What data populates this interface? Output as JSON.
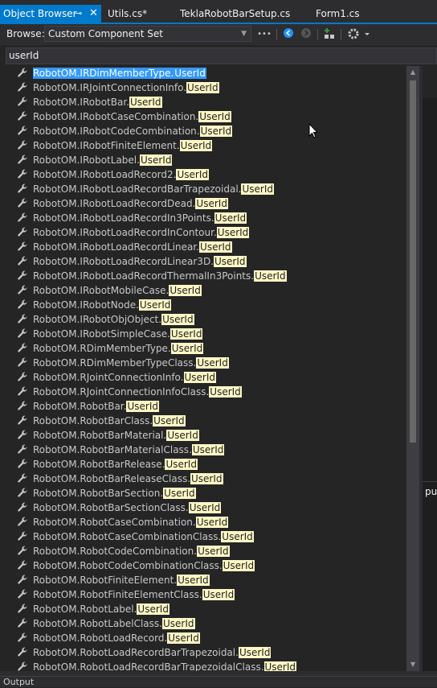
{
  "tabs": {
    "active": "Object Browser",
    "pin_glyph": "⊸",
    "close_glyph": "✕",
    "others": [
      "Utils.cs*",
      "TeklaRobotBarSetup.cs",
      "Form1.cs"
    ]
  },
  "toolbar": {
    "browse_label": "Browse:",
    "browse_value": "Custom Component Set",
    "more": "•••"
  },
  "search": {
    "value": "userId"
  },
  "results": {
    "rows": [
      {
        "prefix": "RobotOM.IRDimMemberType.",
        "match": "UserId"
      },
      {
        "prefix": "RobotOM.IRJointConnectionInfo.",
        "match": "UserId"
      },
      {
        "prefix": "RobotOM.IRobotBar.",
        "match": "UserId"
      },
      {
        "prefix": "RobotOM.IRobotCaseCombination.",
        "match": "UserId"
      },
      {
        "prefix": "RobotOM.IRobotCodeCombination.",
        "match": "UserId"
      },
      {
        "prefix": "RobotOM.IRobotFiniteElement.",
        "match": "UserId"
      },
      {
        "prefix": "RobotOM.IRobotLabel.",
        "match": "UserId"
      },
      {
        "prefix": "RobotOM.IRobotLoadRecord2.",
        "match": "UserId"
      },
      {
        "prefix": "RobotOM.IRobotLoadRecordBarTrapezoidal.",
        "match": "UserId"
      },
      {
        "prefix": "RobotOM.IRobotLoadRecordDead.",
        "match": "UserId"
      },
      {
        "prefix": "RobotOM.IRobotLoadRecordIn3Points.",
        "match": "UserId"
      },
      {
        "prefix": "RobotOM.IRobotLoadRecordInContour.",
        "match": "UserId"
      },
      {
        "prefix": "RobotOM.IRobotLoadRecordLinear.",
        "match": "UserId"
      },
      {
        "prefix": "RobotOM.IRobotLoadRecordLinear3D.",
        "match": "UserId"
      },
      {
        "prefix": "RobotOM.IRobotLoadRecordThermalIn3Points.",
        "match": "UserId"
      },
      {
        "prefix": "RobotOM.IRobotMobileCase.",
        "match": "UserId"
      },
      {
        "prefix": "RobotOM.IRobotNode.",
        "match": "UserId"
      },
      {
        "prefix": "RobotOM.IRobotObjObject.",
        "match": "UserId"
      },
      {
        "prefix": "RobotOM.IRobotSimpleCase.",
        "match": "UserId"
      },
      {
        "prefix": "RobotOM.RDimMemberType.",
        "match": "UserId"
      },
      {
        "prefix": "RobotOM.RDimMemberTypeClass.",
        "match": "UserId"
      },
      {
        "prefix": "RobotOM.RJointConnectionInfo.",
        "match": "UserId"
      },
      {
        "prefix": "RobotOM.RJointConnectionInfoClass.",
        "match": "UserId"
      },
      {
        "prefix": "RobotOM.RobotBar.",
        "match": "UserId"
      },
      {
        "prefix": "RobotOM.RobotBarClass.",
        "match": "UserId"
      },
      {
        "prefix": "RobotOM.RobotBarMaterial.",
        "match": "UserId"
      },
      {
        "prefix": "RobotOM.RobotBarMaterialClass.",
        "match": "UserId"
      },
      {
        "prefix": "RobotOM.RobotBarRelease.",
        "match": "UserId"
      },
      {
        "prefix": "RobotOM.RobotBarReleaseClass.",
        "match": "UserId"
      },
      {
        "prefix": "RobotOM.RobotBarSection.",
        "match": "UserId"
      },
      {
        "prefix": "RobotOM.RobotBarSectionClass.",
        "match": "UserId"
      },
      {
        "prefix": "RobotOM.RobotCaseCombination.",
        "match": "UserId"
      },
      {
        "prefix": "RobotOM.RobotCaseCombinationClass.",
        "match": "UserId"
      },
      {
        "prefix": "RobotOM.RobotCodeCombination.",
        "match": "UserId"
      },
      {
        "prefix": "RobotOM.RobotCodeCombinationClass.",
        "match": "UserId"
      },
      {
        "prefix": "RobotOM.RobotFiniteElement.",
        "match": "UserId"
      },
      {
        "prefix": "RobotOM.RobotFiniteElementClass.",
        "match": "UserId"
      },
      {
        "prefix": "RobotOM.RobotLabel.",
        "match": "UserId"
      },
      {
        "prefix": "RobotOM.RobotLabelClass.",
        "match": "UserId"
      },
      {
        "prefix": "RobotOM.RobotLoadRecord.",
        "match": "UserId"
      },
      {
        "prefix": "RobotOM.RobotLoadRecordBarTrapezoidal.",
        "match": "UserId"
      },
      {
        "prefix": "RobotOM.RobotLoadRecordBarTrapezoidalClass.",
        "match": "UserId"
      }
    ]
  },
  "right_pane": {
    "text": "pu"
  },
  "bottom": {
    "output_label": "Output"
  },
  "colors": {
    "accent": "#007acc",
    "highlight": "#fff8c5",
    "selection": "#3399ff"
  }
}
